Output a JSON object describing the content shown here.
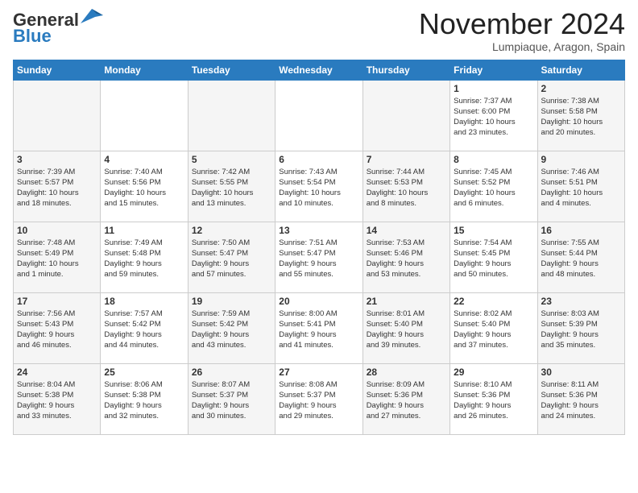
{
  "header": {
    "logo_general": "General",
    "logo_blue": "Blue",
    "month": "November 2024",
    "location": "Lumpiaque, Aragon, Spain"
  },
  "days_of_week": [
    "Sunday",
    "Monday",
    "Tuesday",
    "Wednesday",
    "Thursday",
    "Friday",
    "Saturday"
  ],
  "weeks": [
    [
      {
        "day": "",
        "info": ""
      },
      {
        "day": "",
        "info": ""
      },
      {
        "day": "",
        "info": ""
      },
      {
        "day": "",
        "info": ""
      },
      {
        "day": "",
        "info": ""
      },
      {
        "day": "1",
        "info": "Sunrise: 7:37 AM\nSunset: 6:00 PM\nDaylight: 10 hours\nand 23 minutes."
      },
      {
        "day": "2",
        "info": "Sunrise: 7:38 AM\nSunset: 5:58 PM\nDaylight: 10 hours\nand 20 minutes."
      }
    ],
    [
      {
        "day": "3",
        "info": "Sunrise: 7:39 AM\nSunset: 5:57 PM\nDaylight: 10 hours\nand 18 minutes."
      },
      {
        "day": "4",
        "info": "Sunrise: 7:40 AM\nSunset: 5:56 PM\nDaylight: 10 hours\nand 15 minutes."
      },
      {
        "day": "5",
        "info": "Sunrise: 7:42 AM\nSunset: 5:55 PM\nDaylight: 10 hours\nand 13 minutes."
      },
      {
        "day": "6",
        "info": "Sunrise: 7:43 AM\nSunset: 5:54 PM\nDaylight: 10 hours\nand 10 minutes."
      },
      {
        "day": "7",
        "info": "Sunrise: 7:44 AM\nSunset: 5:53 PM\nDaylight: 10 hours\nand 8 minutes."
      },
      {
        "day": "8",
        "info": "Sunrise: 7:45 AM\nSunset: 5:52 PM\nDaylight: 10 hours\nand 6 minutes."
      },
      {
        "day": "9",
        "info": "Sunrise: 7:46 AM\nSunset: 5:51 PM\nDaylight: 10 hours\nand 4 minutes."
      }
    ],
    [
      {
        "day": "10",
        "info": "Sunrise: 7:48 AM\nSunset: 5:49 PM\nDaylight: 10 hours\nand 1 minute."
      },
      {
        "day": "11",
        "info": "Sunrise: 7:49 AM\nSunset: 5:48 PM\nDaylight: 9 hours\nand 59 minutes."
      },
      {
        "day": "12",
        "info": "Sunrise: 7:50 AM\nSunset: 5:47 PM\nDaylight: 9 hours\nand 57 minutes."
      },
      {
        "day": "13",
        "info": "Sunrise: 7:51 AM\nSunset: 5:47 PM\nDaylight: 9 hours\nand 55 minutes."
      },
      {
        "day": "14",
        "info": "Sunrise: 7:53 AM\nSunset: 5:46 PM\nDaylight: 9 hours\nand 53 minutes."
      },
      {
        "day": "15",
        "info": "Sunrise: 7:54 AM\nSunset: 5:45 PM\nDaylight: 9 hours\nand 50 minutes."
      },
      {
        "day": "16",
        "info": "Sunrise: 7:55 AM\nSunset: 5:44 PM\nDaylight: 9 hours\nand 48 minutes."
      }
    ],
    [
      {
        "day": "17",
        "info": "Sunrise: 7:56 AM\nSunset: 5:43 PM\nDaylight: 9 hours\nand 46 minutes."
      },
      {
        "day": "18",
        "info": "Sunrise: 7:57 AM\nSunset: 5:42 PM\nDaylight: 9 hours\nand 44 minutes."
      },
      {
        "day": "19",
        "info": "Sunrise: 7:59 AM\nSunset: 5:42 PM\nDaylight: 9 hours\nand 43 minutes."
      },
      {
        "day": "20",
        "info": "Sunrise: 8:00 AM\nSunset: 5:41 PM\nDaylight: 9 hours\nand 41 minutes."
      },
      {
        "day": "21",
        "info": "Sunrise: 8:01 AM\nSunset: 5:40 PM\nDaylight: 9 hours\nand 39 minutes."
      },
      {
        "day": "22",
        "info": "Sunrise: 8:02 AM\nSunset: 5:40 PM\nDaylight: 9 hours\nand 37 minutes."
      },
      {
        "day": "23",
        "info": "Sunrise: 8:03 AM\nSunset: 5:39 PM\nDaylight: 9 hours\nand 35 minutes."
      }
    ],
    [
      {
        "day": "24",
        "info": "Sunrise: 8:04 AM\nSunset: 5:38 PM\nDaylight: 9 hours\nand 33 minutes."
      },
      {
        "day": "25",
        "info": "Sunrise: 8:06 AM\nSunset: 5:38 PM\nDaylight: 9 hours\nand 32 minutes."
      },
      {
        "day": "26",
        "info": "Sunrise: 8:07 AM\nSunset: 5:37 PM\nDaylight: 9 hours\nand 30 minutes."
      },
      {
        "day": "27",
        "info": "Sunrise: 8:08 AM\nSunset: 5:37 PM\nDaylight: 9 hours\nand 29 minutes."
      },
      {
        "day": "28",
        "info": "Sunrise: 8:09 AM\nSunset: 5:36 PM\nDaylight: 9 hours\nand 27 minutes."
      },
      {
        "day": "29",
        "info": "Sunrise: 8:10 AM\nSunset: 5:36 PM\nDaylight: 9 hours\nand 26 minutes."
      },
      {
        "day": "30",
        "info": "Sunrise: 8:11 AM\nSunset: 5:36 PM\nDaylight: 9 hours\nand 24 minutes."
      }
    ]
  ]
}
